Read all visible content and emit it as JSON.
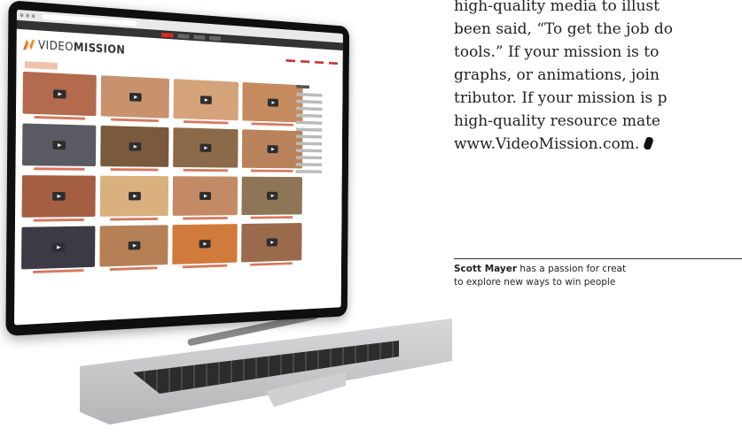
{
  "article": {
    "lines": [
      "high-quality media to illust",
      "been said, “To get the job do",
      "tools.” If your mission is to",
      "graphs, or animations, join",
      "tributor. If your mission is p",
      "high-quality resource mate",
      "www.VideoMission.com."
    ],
    "bio_name": "Scott Mayer",
    "bio_line1_rest": " has a passion for creat",
    "bio_line2": "to explore new ways to win people"
  },
  "laptop_screen": {
    "logo_text_light": "VIDEO",
    "logo_text_bold": "MISSION"
  },
  "colors": {
    "accent": "#d92b1d",
    "logo_orange": "#e6671c"
  },
  "thumbnails": [
    {
      "color": "#b46a4c",
      "icon": "play-icon"
    },
    {
      "color": "#c8926c",
      "icon": "play-icon"
    },
    {
      "color": "#d5a37a",
      "icon": "play-icon"
    },
    {
      "color": "#c58b5e",
      "icon": "play-icon"
    },
    {
      "color": "#5a5a62",
      "icon": "play-icon"
    },
    {
      "color": "#7a5a3c",
      "icon": "play-icon"
    },
    {
      "color": "#8a6a48",
      "icon": "play-icon"
    },
    {
      "color": "#b9825a",
      "icon": "play-icon"
    },
    {
      "color": "#a45e42",
      "icon": "play-icon"
    },
    {
      "color": "#d9b07e",
      "icon": "play-icon"
    },
    {
      "color": "#c48a66",
      "icon": "play-icon"
    },
    {
      "color": "#8d7556",
      "icon": "play-icon"
    },
    {
      "color": "#3c3a44",
      "icon": "play-icon"
    },
    {
      "color": "#b58056",
      "icon": "play-icon"
    },
    {
      "color": "#d07a3c",
      "icon": "play-icon"
    },
    {
      "color": "#9a6a4c",
      "icon": "play-icon"
    }
  ]
}
